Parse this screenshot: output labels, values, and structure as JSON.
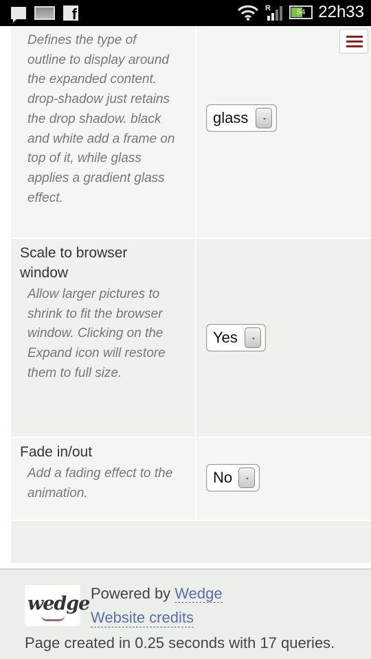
{
  "status_bar": {
    "icons_left": [
      "message-icon",
      "gallery-icon",
      "facebook-icon"
    ],
    "facebook_glyph": "f",
    "roaming": "R",
    "battery_level": "54",
    "time": "22h33",
    "battery_color": "#7cc242"
  },
  "menu": {
    "icon": "hamburger-menu-icon",
    "color": "#9b1b1b"
  },
  "settings": [
    {
      "label": "",
      "description": "Defines the type of outline to display around the expanded content. drop-shadow just retains the drop shadow. black and white add a frame on top of it, while glass applies a gradient glass effect.",
      "value": "glass"
    },
    {
      "label": "Scale to browser window",
      "description": "Allow larger pictures to shrink to fit the browser window. Clicking on the Expand icon will restore them to full size.",
      "value": "Yes"
    },
    {
      "label": "Fade in/out",
      "description": "Add a fading effect to the animation.",
      "value": "No"
    }
  ],
  "footer": {
    "logo_text": "wedge",
    "powered_by": "Powered by",
    "powered_link": "Wedge",
    "credits_link": "Website credits",
    "page_created": "Page created in 0.25 seconds with 17 queries."
  }
}
